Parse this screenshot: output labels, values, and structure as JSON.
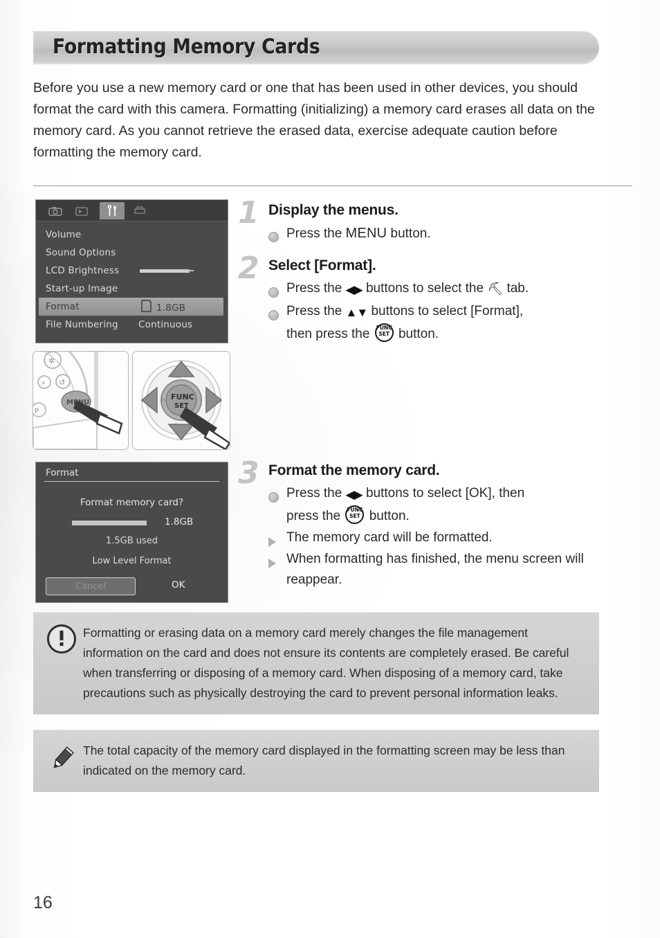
{
  "page": {
    "number": "16"
  },
  "header": {
    "title": "Formatting Memory Cards"
  },
  "intro": {
    "paragraph": "Before you use a new memory card or one that has been used in other devices, you should format the card with this camera. Formatting (initializing) a memory card erases all data on the memory card. As you cannot retrieve the erased data, exercise adequate caution before formatting the memory card."
  },
  "lcd_menu": {
    "tabs": [
      "camera-tab",
      "playback-tab",
      "tools-tab",
      "print-tab"
    ],
    "selected_tab": "tools-tab",
    "rows": [
      {
        "label": "Volume",
        "value": ""
      },
      {
        "label": "Sound Options",
        "value": ""
      },
      {
        "label": "LCD Brightness",
        "value": ""
      },
      {
        "label": "Start-up Image",
        "value": ""
      },
      {
        "label": "Format",
        "value": "1.8GB"
      },
      {
        "label": "File Numbering",
        "value": "Continuous"
      }
    ],
    "selected_row": "Format"
  },
  "lcd_format": {
    "title": "Format",
    "question": "Format memory card?",
    "total_capacity": "1.8GB",
    "used": "1.5GB used",
    "low_level_option": "Low Level Format",
    "cancel_label": "Cancel",
    "ok_label": "OK"
  },
  "illustrations": {
    "menu_button": "menu-button-press-illustration",
    "control_pad": "four-way-controller-illustration",
    "control_pad_center": "FUNC SET"
  },
  "steps": [
    {
      "number": "1",
      "title": "Display the menus.",
      "items": [
        {
          "marker": "dot",
          "pre": "Press the ",
          "glyph": "",
          "post": "",
          "menu_word": "MENU",
          "tail": " button."
        }
      ]
    },
    {
      "number": "2",
      "title": "Select [Format].",
      "items": [
        {
          "marker": "dot",
          "pre": "Press the ",
          "glyph": "lr-arrows",
          "mid": " buttons to select the ",
          "glyph2": "tools-tab",
          "post": " tab."
        },
        {
          "marker": "dot",
          "pre": "Press the ",
          "glyph": "ud-arrows",
          "mid": " buttons to select [Format],",
          "line2_pre": "then press the ",
          "glyph2": "func-set",
          "line2_post": " button."
        }
      ]
    },
    {
      "number": "3",
      "title": "Format the memory card.",
      "items": [
        {
          "marker": "dot",
          "pre": "Press the ",
          "glyph": "lr-arrows",
          "mid": " buttons to select [OK], then",
          "line2_pre": "press the ",
          "glyph2": "func-set",
          "line2_post": " button."
        },
        {
          "marker": "triangle",
          "text": "The memory card will be formatted."
        },
        {
          "marker": "triangle",
          "text": "When formatting has finished, the menu screen will reappear."
        }
      ]
    }
  ],
  "callouts": {
    "warning": {
      "icon": "exclamation-circle-icon",
      "text": "Formatting or erasing data on a memory card merely changes the file management information on the card and does not ensure its contents are completely erased. Be careful when transferring or disposing of a memory card. When disposing of a memory card, take precautions such as physically destroying the card to prevent personal information leaks."
    },
    "note": {
      "icon": "pencil-icon",
      "text": "The total capacity of the memory card displayed in the formatting screen may be less than indicated on the memory card."
    }
  },
  "colors": {
    "banner": "#c9c9c9",
    "callout_bg": "#d0d0ce",
    "lcd_bg": "#4a4a4a",
    "step_number": "#c4c4c4"
  }
}
